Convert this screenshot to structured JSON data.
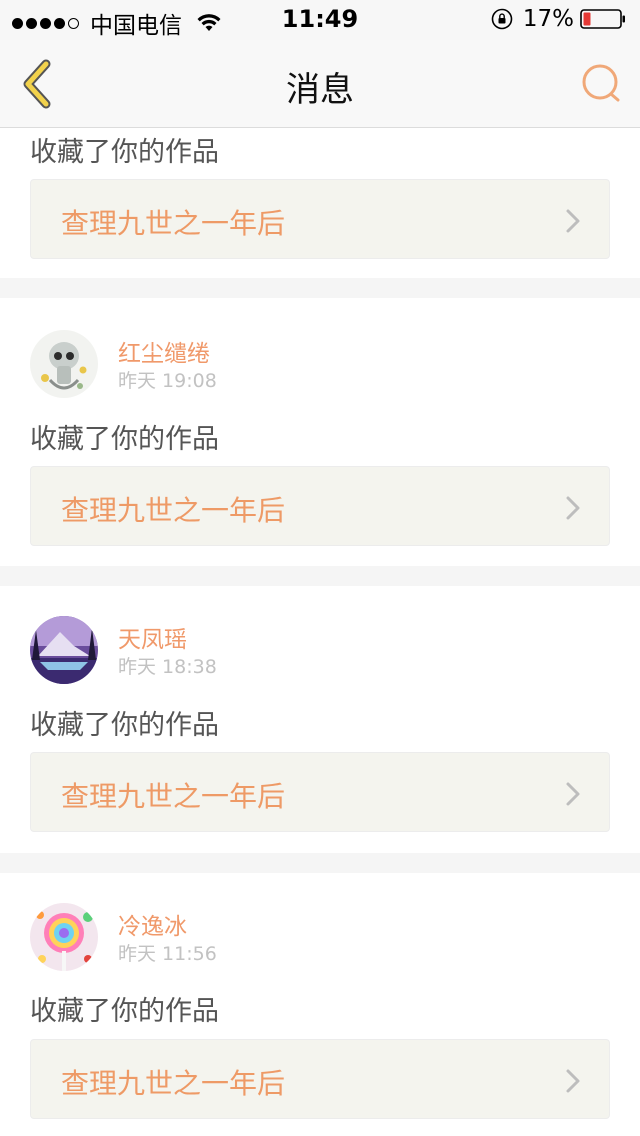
{
  "status_bar": {
    "carrier": "中国电信",
    "time": "11:49",
    "battery": "17%"
  },
  "nav": {
    "title": "消息",
    "back_icon": "chevron-left-icon",
    "search_icon": "search-icon"
  },
  "colors": {
    "accent": "#f0996a",
    "back_arrow": "#f2c94c",
    "link_bg": "#f4f4ee",
    "battery_low": "#e53935"
  },
  "messages": [
    {
      "user": "",
      "time": "",
      "action": "收藏了你的作品",
      "work_title": "查理九世之一年后"
    },
    {
      "user": "红尘缱绻",
      "time": "昨天 19:08",
      "action": "收藏了你的作品",
      "work_title": "查理九世之一年后"
    },
    {
      "user": "天凤瑶",
      "time": "昨天 18:38",
      "action": "收藏了你的作品",
      "work_title": "查理九世之一年后"
    },
    {
      "user": "冷逸冰",
      "time": "昨天 11:56",
      "action": "收藏了你的作品",
      "work_title": "查理九世之一年后"
    }
  ]
}
